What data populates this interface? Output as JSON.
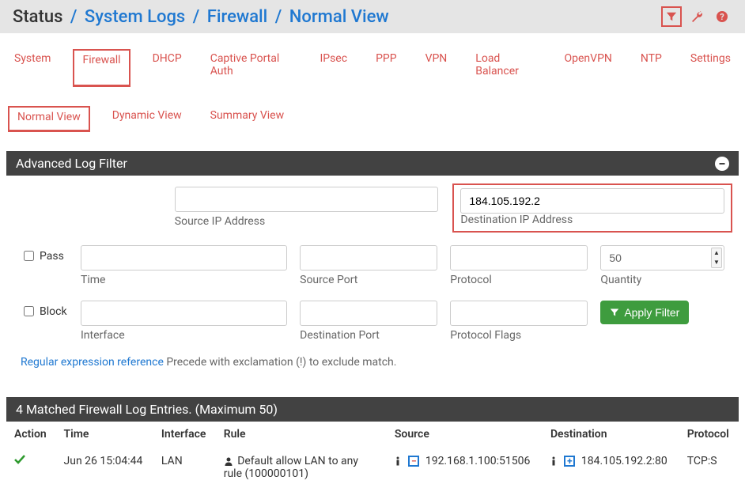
{
  "breadcrumb": {
    "root": "Status",
    "links": [
      "System Logs",
      "Firewall",
      "Normal View"
    ]
  },
  "tabs_level1": [
    {
      "label": "System"
    },
    {
      "label": "Firewall",
      "active": true
    },
    {
      "label": "DHCP"
    },
    {
      "label": "Captive Portal Auth"
    },
    {
      "label": "IPsec"
    },
    {
      "label": "PPP"
    },
    {
      "label": "VPN"
    },
    {
      "label": "Load Balancer"
    },
    {
      "label": "OpenVPN"
    },
    {
      "label": "NTP"
    },
    {
      "label": "Settings"
    }
  ],
  "tabs_level2": [
    {
      "label": "Normal View",
      "active": true
    },
    {
      "label": "Dynamic View"
    },
    {
      "label": "Summary View"
    }
  ],
  "filter": {
    "title": "Advanced Log Filter",
    "source_ip": "",
    "source_ip_label": "Source IP Address",
    "dest_ip": "184.105.192.2",
    "dest_ip_label": "Destination IP Address",
    "pass_label": "Pass",
    "block_label": "Block",
    "time": "",
    "time_label": "Time",
    "source_port": "",
    "source_port_label": "Source Port",
    "protocol": "",
    "protocol_label": "Protocol",
    "quantity": "50",
    "quantity_label": "Quantity",
    "interface": "",
    "interface_label": "Interface",
    "dest_port": "",
    "dest_port_label": "Destination Port",
    "proto_flags": "",
    "proto_flags_label": "Protocol Flags",
    "apply_label": "Apply Filter",
    "help_link": "Regular expression reference",
    "help_text": " Precede with exclamation (!) to exclude match."
  },
  "results": {
    "title": "4 Matched Firewall Log Entries. (Maximum 50)",
    "headers": {
      "action": "Action",
      "time": "Time",
      "interface": "Interface",
      "rule": "Rule",
      "source": "Source",
      "destination": "Destination",
      "protocol": "Protocol"
    },
    "rows": [
      {
        "action": "pass",
        "time": "Jun 26 15:04:44",
        "interface": "LAN",
        "rule": "Default allow LAN to any rule (100000101)",
        "source": "192.168.1.100:51506",
        "destination": "184.105.192.2:80",
        "protocol": "TCP:S"
      }
    ]
  }
}
